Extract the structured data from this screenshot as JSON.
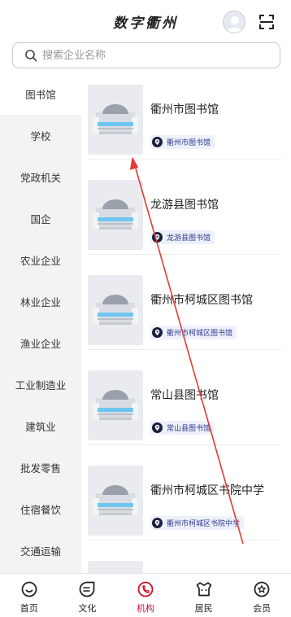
{
  "header": {
    "title": "数字衢州",
    "avatar_icon": "avatar-icon",
    "scan_icon": "scan-icon"
  },
  "search": {
    "placeholder": "搜索企业名称",
    "value": ""
  },
  "sidebar": {
    "active_index": 0,
    "items": [
      {
        "label": "图书馆"
      },
      {
        "label": "学校"
      },
      {
        "label": "党政机关"
      },
      {
        "label": "国企"
      },
      {
        "label": "农业企业"
      },
      {
        "label": "林业企业"
      },
      {
        "label": "渔业企业"
      },
      {
        "label": "工业制造业"
      },
      {
        "label": "建筑业"
      },
      {
        "label": "批发零售"
      },
      {
        "label": "住宿餐饮"
      },
      {
        "label": "交通运输"
      }
    ]
  },
  "list": {
    "items": [
      {
        "title": "衢州市图书馆",
        "tag": "衢州市图书馆"
      },
      {
        "title": "龙游县图书馆",
        "tag": "龙游县图书馆"
      },
      {
        "title": "衢州市柯城区图书馆",
        "tag": "衢州市柯城区图书馆"
      },
      {
        "title": "常山县图书馆",
        "tag": "常山县图书馆"
      },
      {
        "title": "衢州市柯城区书院中学",
        "tag": "衢州市柯城区书院中学"
      }
    ]
  },
  "tabbar": {
    "active_index": 2,
    "active_color": "#c8102e",
    "items": [
      {
        "label": "首页",
        "icon": "home-icon"
      },
      {
        "label": "文化",
        "icon": "culture-icon"
      },
      {
        "label": "机构",
        "icon": "institution-icon"
      },
      {
        "label": "居民",
        "icon": "residents-icon"
      },
      {
        "label": "会员",
        "icon": "member-icon"
      }
    ]
  },
  "annotation": {
    "color": "#e53935"
  }
}
